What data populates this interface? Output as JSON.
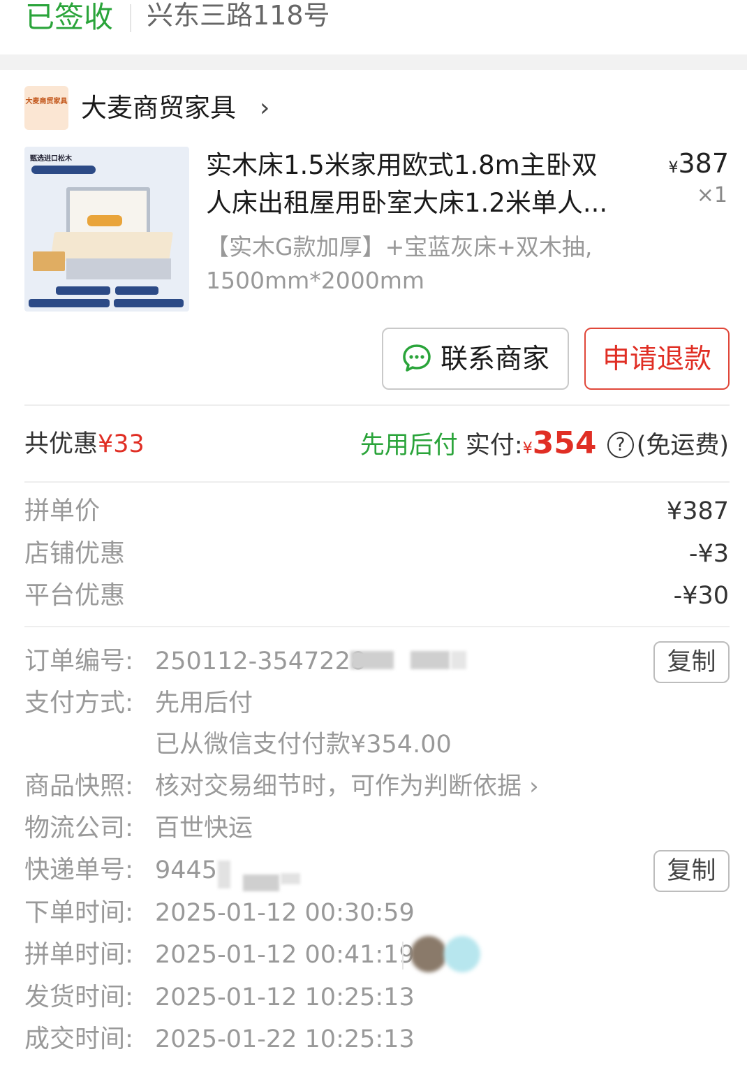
{
  "status": {
    "label": "已签收",
    "address": "兴东三路118号"
  },
  "shop": {
    "logo_text": "大麦商贸家具",
    "name": "大麦商贸家具",
    "chevron": "›"
  },
  "product": {
    "image_caption": "甄选进口松木",
    "title_line1": "实木床1.5米家用欧式1.8m主卧双",
    "title_line2": "人床出租屋用卧室大床1.2米单人...",
    "price_symbol": "¥",
    "price": "387",
    "quantity": "×1",
    "spec_line1": "【实木G款加厚】+宝蓝灰床+双木抽,",
    "spec_line2": "1500mm*2000mm"
  },
  "actions": {
    "contact_label": "联系商家",
    "refund_label": "申请退款"
  },
  "summary": {
    "savings_label": "共优惠",
    "savings_amount": "¥33",
    "pay_later": "先用后付",
    "paid_label": "实付:",
    "paid_symbol": "¥",
    "paid_amount": "354",
    "help_glyph": "?",
    "shipping_note": "(免运费)"
  },
  "breakdown": [
    {
      "label": "拼单价",
      "value": "¥387"
    },
    {
      "label": "店铺优惠",
      "value": "-¥3"
    },
    {
      "label": "平台优惠",
      "value": "-¥30"
    }
  ],
  "details": {
    "order_no_label": "订单编号:",
    "order_no_value": "250112-3547228",
    "copy_label": "复制",
    "payment_label": "支付方式:",
    "payment_value": "先用后付",
    "payment_note": "已从微信支付付款¥354.00",
    "snapshot_label": "商品快照:",
    "snapshot_value": "核对交易细节时，可作为判断依据",
    "snapshot_chevron": "›",
    "courier_label": "物流公司:",
    "courier_value": "百世快运",
    "tracking_label": "快递单号:",
    "tracking_value": "9445",
    "order_time_label": "下单时间:",
    "order_time_value": "2025-01-12 00:30:59",
    "group_time_label": "拼单时间:",
    "group_time_value": "2025-01-12 00:41:19",
    "ship_time_label": "发货时间:",
    "ship_time_value": "2025-01-12 10:25:13",
    "deal_time_label": "成交时间:",
    "deal_time_value": "2025-01-22 10:25:13"
  },
  "colors": {
    "status_green": "#2aa43a",
    "price_red": "#e02e24",
    "muted_gray": "#999999"
  }
}
